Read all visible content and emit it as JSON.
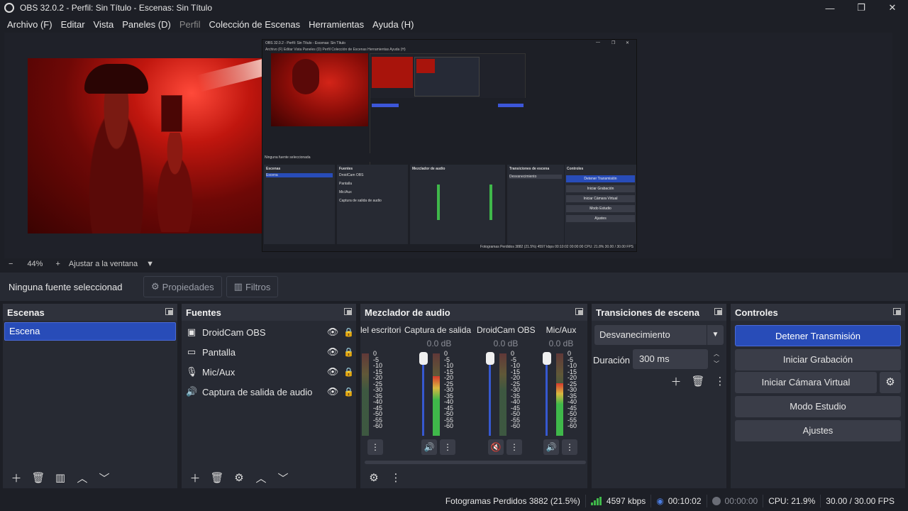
{
  "window": {
    "title": "OBS 32.0.2 - Perfil: Sin Título - Escenas: Sin Título",
    "minimize_glyph": "—",
    "restore_glyph": "❐",
    "close_glyph": "✕"
  },
  "menu": [
    "Archivo (F)",
    "Editar",
    "Vista",
    "Paneles (D)",
    "Perfil",
    "Colección de Escenas",
    "Herramientas",
    "Ayuda (H)"
  ],
  "nested_preview": {
    "title": "OBS 32.0.2 - Perfil: Sin Título - Escenas: Sin Título",
    "menu": "Archivo (F)   Editar   Vista   Paneles (D)   Perfil   Colección de Escenas   Herramientas   Ayuda (H)",
    "source_bar": "Ninguna fuente seleccionada",
    "scenes_title": "Escenas",
    "scene": "Escena",
    "sources_title": "Fuentes",
    "sources": [
      "DroidCam OBS",
      "Pantalla",
      "Mic/Aux",
      "Captura de salida de audio"
    ],
    "mixer_title": "Mezclador de audio",
    "trans_title": "Transiciones de escena",
    "trans_value": "Desvanecimiento",
    "controls_title": "Controles",
    "buttons": [
      "Detener Transmisión",
      "Iniciar Grabación",
      "Iniciar Cámara Virtual",
      "Modo Estudio",
      "Ajustes"
    ],
    "status": "Fotogramas Perdidos 3882 (21.5%)   4597 kbps   00:10:02   00:00:00   CPU: 21.8%   30.00 / 30.00 FPS"
  },
  "zoom": {
    "minus": "−",
    "value": "44%",
    "plus": "+",
    "fit_label": "Ajustar a la ventana",
    "dropdown": "▼"
  },
  "source_toolbar": {
    "no_source": "Ninguna fuente seleccionada",
    "properties": "Propiedades",
    "filters": "Filtros"
  },
  "scenes": {
    "title": "Escenas",
    "items": [
      "Escena"
    ]
  },
  "sources": {
    "title": "Fuentes",
    "items": [
      {
        "name": "DroidCam OBS",
        "icon": "camera-icon"
      },
      {
        "name": "Pantalla",
        "icon": "monitor-icon"
      },
      {
        "name": "Mic/Aux",
        "icon": "microphone-icon"
      },
      {
        "name": "Captura de salida de audio",
        "icon": "speaker-icon"
      }
    ]
  },
  "mixer": {
    "title": "Mezclador de audio",
    "channels": [
      {
        "name": "lel escritorio",
        "db": "",
        "level": 0.0
      },
      {
        "name": "Captura de salida c",
        "db": "0.0 dB",
        "level": 0.72
      },
      {
        "name": "DroidCam OBS",
        "db": "0.0 dB",
        "level": 0.0
      },
      {
        "name": "Mic/Aux",
        "db": "0.0 dB",
        "level": 0.64
      }
    ],
    "scale": "0\n-5\n-10\n-15\n-20\n-25\n-30\n-35\n-40\n-45\n-50\n-55\n-60"
  },
  "transitions": {
    "title": "Transiciones de escena",
    "selected": "Desvanecimiento",
    "duration_label": "Duración",
    "duration_value": "300 ms"
  },
  "controls": {
    "title": "Controles",
    "stream": "Detener Transmisión",
    "record": "Iniciar Grabación",
    "virtualcam": "Iniciar Cámara Virtual",
    "studio": "Modo Estudio",
    "settings": "Ajustes"
  },
  "status": {
    "dropped": "Fotogramas Perdidos 3882 (21.5%)",
    "bitrate": "4597 kbps",
    "stream_time": "00:10:02",
    "record_time": "00:00:00",
    "cpu": "CPU: 21.9%",
    "fps": "30.00 / 30.00 FPS"
  },
  "colors": {
    "accent": "#284cb8",
    "panel": "#272a33",
    "background": "#1d1f26",
    "meter_green": "#3fb84a",
    "mute_red": "#d43a2c"
  }
}
